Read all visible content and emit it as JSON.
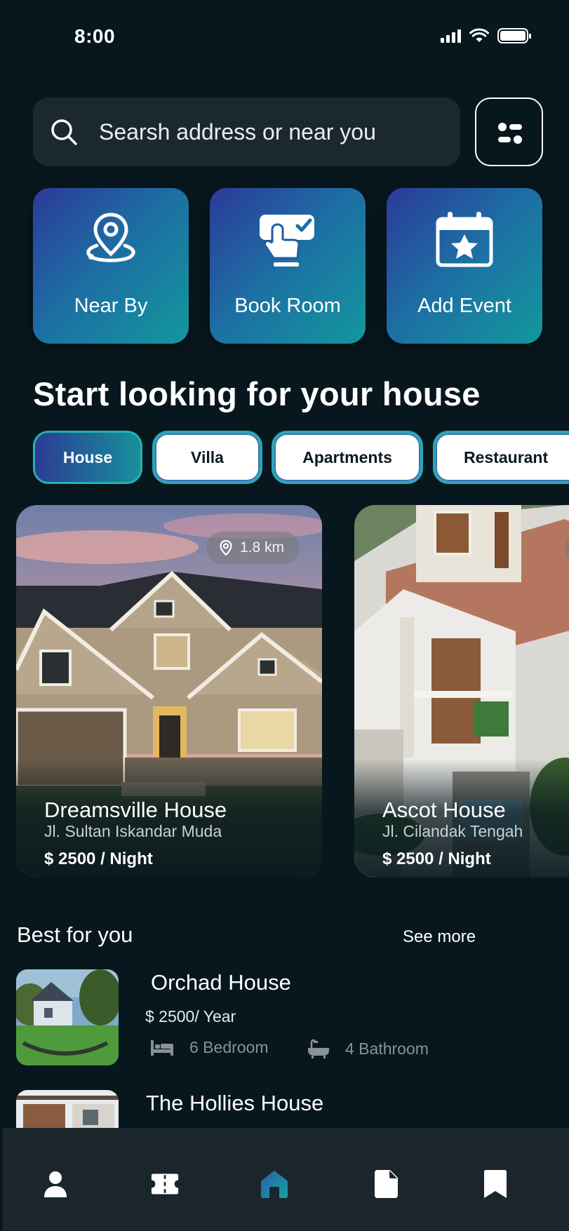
{
  "status_bar": {
    "time": "8:00"
  },
  "search": {
    "placeholder": "Searsh address or near you"
  },
  "quick_actions": [
    {
      "label": "Near By",
      "icon": "location-pin-icon"
    },
    {
      "label": "Book Room",
      "icon": "touch-booking-icon"
    },
    {
      "label": "Add Event",
      "icon": "calendar-star-icon"
    }
  ],
  "section_heading": "Start looking for your house",
  "categories": [
    {
      "label": "House",
      "active": true
    },
    {
      "label": "Villa",
      "active": false
    },
    {
      "label": "Apartments",
      "active": false
    },
    {
      "label": "Restaurant",
      "active": false
    }
  ],
  "cards": [
    {
      "name": "Dreamsville House",
      "address": "Jl. Sultan Iskandar Muda",
      "price": "$ 2500 / Night",
      "distance": "1.8 km"
    },
    {
      "name": "Ascot House",
      "address": "Jl. Cilandak Tengah",
      "price": "$ 2500 / Night",
      "distance": ""
    }
  ],
  "best_for_you": {
    "title": "Best for you",
    "see_more": "See more",
    "items": [
      {
        "name": "Orchad House",
        "price": "$ 2500/ Year",
        "bedrooms": "6 Bedroom",
        "bathrooms": "4 Bathroom"
      },
      {
        "name": "The Hollies House"
      }
    ]
  },
  "nav": [
    {
      "name": "profile",
      "icon": "person-icon",
      "active": false
    },
    {
      "name": "tickets",
      "icon": "ticket-icon",
      "active": false
    },
    {
      "name": "home",
      "icon": "home-icon",
      "active": true
    },
    {
      "name": "documents",
      "icon": "document-icon",
      "active": false
    },
    {
      "name": "saved",
      "icon": "bookmark-icon",
      "active": false
    }
  ],
  "colors": {
    "background": "#07171d",
    "accent_teal": "#18989c",
    "accent_indigo": "#2b3a98",
    "nav_bg": "#1a262c",
    "nav_active": "#1d8fb0"
  }
}
